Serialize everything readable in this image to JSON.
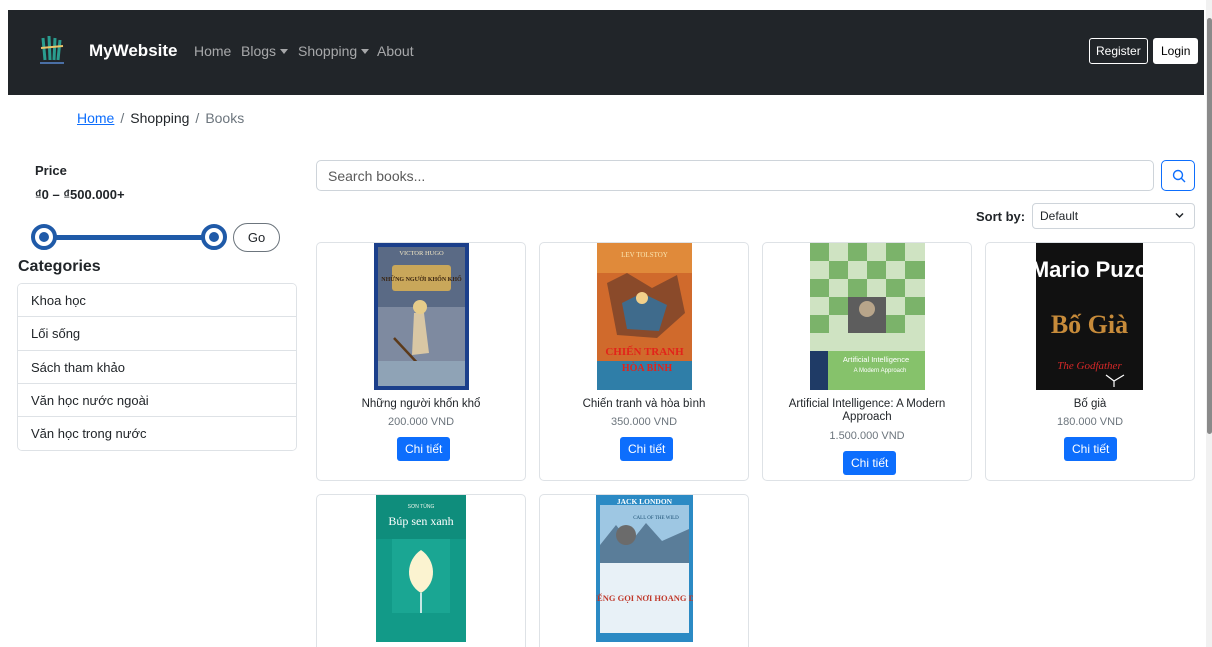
{
  "navbar": {
    "brand": "MyWebsite",
    "items": [
      {
        "label": "Home"
      },
      {
        "label": "Blogs"
      },
      {
        "label": "Shopping"
      },
      {
        "label": "About"
      }
    ],
    "register_label": "Register",
    "login_label": "Login"
  },
  "breadcrumb": {
    "home": "Home",
    "sep": "/",
    "shopping": "Shopping",
    "current": "Books"
  },
  "sidebar": {
    "price_title": "Price",
    "price_range": "₫0 – ₫500.000+",
    "price_min_fraction": 0,
    "price_max_fraction": 1,
    "go_label": "Go",
    "categories_title": "Categories",
    "categories": [
      {
        "label": "Khoa học"
      },
      {
        "label": "Lối sống"
      },
      {
        "label": "Sách tham khảo"
      },
      {
        "label": "Văn học nước ngoài"
      },
      {
        "label": "Văn học trong nước"
      }
    ]
  },
  "search": {
    "placeholder": "Search books...",
    "value": ""
  },
  "sort": {
    "label": "Sort by:",
    "selected": "Default"
  },
  "products": [
    {
      "name": "Những người khốn khổ",
      "price": "200.000 VND",
      "button": "Chi tiết",
      "cover_author": "VICTOR HUGO",
      "cover_title": "NHỮNG NGƯỜI KHỐN KHỔ"
    },
    {
      "name": "Chiến tranh và hòa bình",
      "price": "350.000 VND",
      "button": "Chi tiết",
      "cover_author": "LEV TOLSTOY",
      "cover_title": "CHIẾN TRANH",
      "cover_title2": "HÒA BÌNH"
    },
    {
      "name": "Artificial Intelligence: A Modern Approach",
      "price": "1.500.000 VND",
      "button": "Chi tiết",
      "cover_title": "Artificial Intelligence",
      "cover_sub": "A Modern Approach"
    },
    {
      "name": "Bố già",
      "price": "180.000 VND",
      "button": "Chi tiết",
      "cover_author": "Mario Puzo",
      "cover_title": "Bố Già",
      "cover_sub": "The Godfather"
    },
    {
      "name": "",
      "price": "",
      "button": "",
      "cover_author": "SƠN TÙNG",
      "cover_title": "Búp sen xanh"
    },
    {
      "name": "",
      "price": "",
      "button": "",
      "cover_author": "JACK LONDON",
      "cover_sub": "CALL OF THE WILD",
      "cover_title": "TIẾNG GỌI NƠI HOANG DÃ"
    }
  ],
  "colors": {
    "navbar_bg": "#212529",
    "primary": "#0d6efd",
    "slider": "#1f5aa8"
  }
}
